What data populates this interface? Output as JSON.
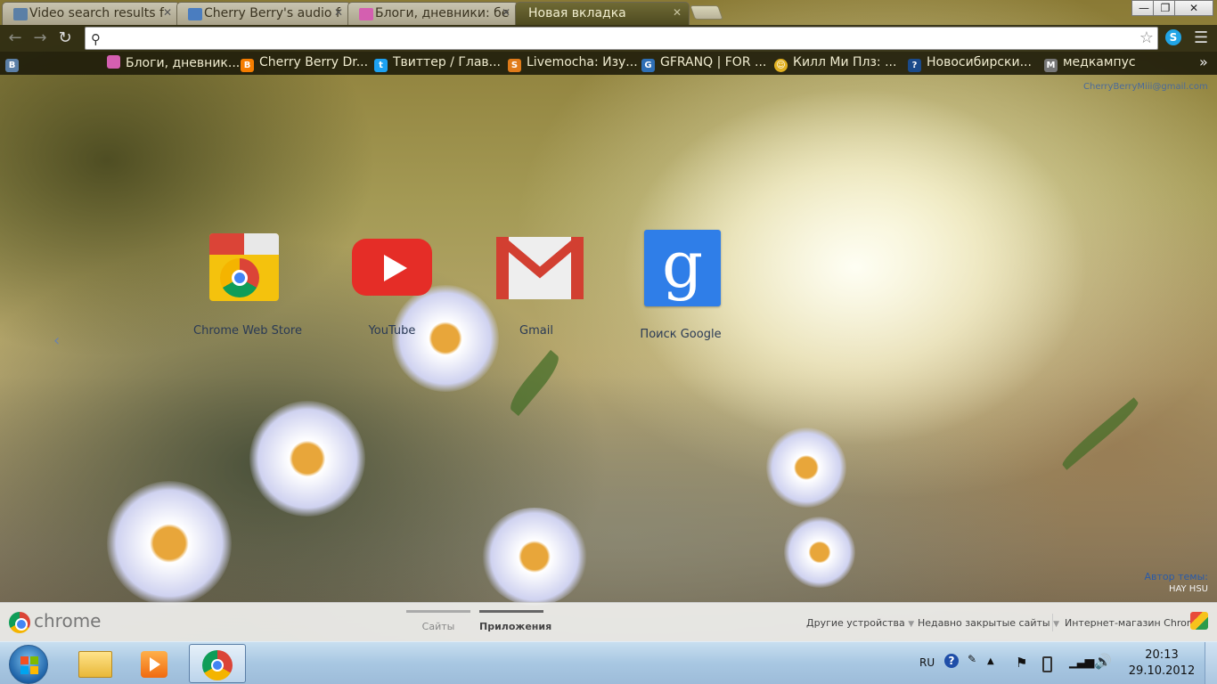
{
  "tabs": [
    {
      "title": "Video search results f",
      "favicon": "vk-icon",
      "color": "#5b7fa6"
    },
    {
      "title": "Cherry Berry's audio f",
      "favicon": "video-icon",
      "color": "#4a7dc0"
    },
    {
      "title": "Блоги, дневники: бе",
      "favicon": "diary-icon",
      "color": "#d45fb0"
    },
    {
      "title": "Новая вкладка",
      "favicon": "",
      "color": ""
    }
  ],
  "window_controls": {
    "minimize": "—",
    "maximize": "❐",
    "close": "✕"
  },
  "omnibox": {
    "value": "",
    "placeholder": ""
  },
  "bookmarks": [
    {
      "label": "Блоги, дневник...",
      "icon": "diary-icon",
      "color": "#d45fb0"
    },
    {
      "label": "Cherry Berry Dr...",
      "icon": "blogger-icon",
      "color": "#f57d00"
    },
    {
      "label": "Твиттер / Глав...",
      "icon": "twitter-icon",
      "color": "#1da1f2"
    },
    {
      "label": "Livemocha: Изу...",
      "icon": "livemocha-icon",
      "color": "#e07b1a"
    },
    {
      "label": "GFRANQ | FOR ...",
      "icon": "gfranq-icon",
      "color": "#2f6fb5"
    },
    {
      "label": "Килл Ми Плз: ...",
      "icon": "smiley-icon",
      "color": "#e0b020"
    },
    {
      "label": "Новосибирски...",
      "icon": "nsk-icon",
      "color": "#1a4a8a"
    },
    {
      "label": "медкампус",
      "icon": "medcampus-icon",
      "color": "#777777"
    }
  ],
  "account_email": "CherryBerryMiii@gmail.com",
  "apps": [
    {
      "label": "Chrome Web Store",
      "icon": "chrome-web-store-icon"
    },
    {
      "label": "YouTube",
      "icon": "youtube-icon"
    },
    {
      "label": "Gmail",
      "icon": "gmail-icon"
    },
    {
      "label": "Поиск Google",
      "icon": "google-search-icon"
    }
  ],
  "theme_author": {
    "label": "Автор темы:",
    "name": "HAY HSU"
  },
  "ntp_bar": {
    "brand": "chrome",
    "page_tabs": [
      {
        "label": "Сайты",
        "selected": false
      },
      {
        "label": "Приложения",
        "selected": true
      }
    ],
    "other_devices": "Другие устройства",
    "recently_closed": "Недавно закрытые сайты",
    "web_store": "Интернет-магазин Chrome"
  },
  "taskbar": {
    "language": "RU",
    "time": "20:13",
    "date": "29.10.2012",
    "pinned": [
      "explorer-icon",
      "media-player-icon",
      "chrome-icon"
    ]
  }
}
